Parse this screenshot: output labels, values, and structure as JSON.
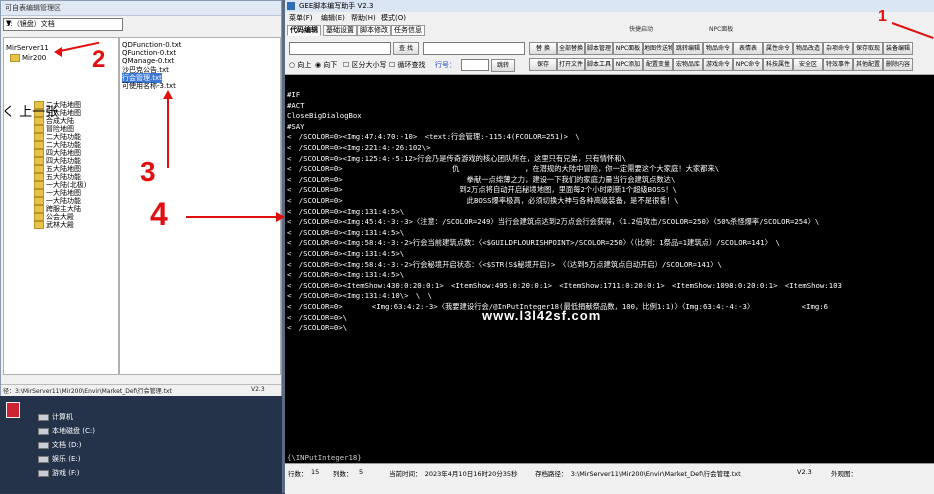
{
  "left_window": {
    "title": "可自表编辑管理区",
    "path_combo": "3:（镜盘）文档",
    "tree_root": "MirServer11",
    "tree_sub": "Mir200",
    "tree_items": [
      "二大陆地图",
      "三大陆地图",
      "合成大陆",
      "冒险地图",
      "二大陆功能",
      "二大陆功能",
      "四大陆地图",
      "四大陆功能",
      "五大陆地图",
      "五大陆功能",
      "一大陆(北极)",
      "一大陆地图",
      "一大陆功能",
      "跨服主大陆",
      "公会大殿",
      "武林大殿"
    ],
    "files": [
      "QDFunction-0.txt",
      "QFunction-0.txt",
      "QManage-0.txt",
      "沙巴克公告.txt",
      "行会管理.txt",
      "可使用名称-3.txt"
    ],
    "selected_file": "行会管理.txt",
    "status_path": "径：3:\\MirServer11\\Mir200\\Envir\\Market_Def\\行会管理.txt",
    "status_version": "V2.3"
  },
  "desktop": {
    "items": [
      "计算机",
      "本地磁盘 (C:)",
      "文档 (D:)",
      "娱乐 (E:)",
      "游戏 (F:)"
    ]
  },
  "right_window": {
    "title": "GEE脚本编写助手 V2.3",
    "menu": [
      "菜单(F)",
      "编辑(E)",
      "帮助(H)",
      "模式(O)"
    ],
    "tabs": [
      "代码编辑",
      "基础设置",
      "脚本修改",
      "任务信息"
    ],
    "group_labels": {
      "quick": "快捷启动",
      "npc": "NPC面板"
    },
    "search_btn": "查 找",
    "toolbar_row1": [
      "替 换",
      "全部替换",
      "脚本管理",
      "NPC面板",
      "地图传送物品",
      "跳转编辑",
      "物品命令",
      "表情表",
      "属性命令",
      "物品改造",
      "杂项命令",
      "保存取现",
      "装备编辑"
    ],
    "radio_up": "向上",
    "radio_down": "向下",
    "check_case": "区分大小写",
    "check_loop": "循环查找",
    "line_label": "行号：",
    "goto_btn": "跳转",
    "toolbar_row2": [
      "保存",
      "打开文件",
      "脚本工具",
      "NPC添加",
      "配置变量",
      "宏物品库",
      "游戏命令",
      "NPC命令",
      "科技属性",
      "安全区",
      "特效事件",
      "其他配置",
      "删除内容"
    ]
  },
  "editor_lines": [
    "#IF",
    "#ACT",
    "CloseBigDialogBox",
    "#SAY",
    "<　/SCOLOR=0><Img:47:4:70:-10>　<text:行会管理:-115:4(FCOLOR=251)>　\\",
    "<　/SCOLOR=0><Img:221:4:-26:102\\>",
    "<　/SCOLOR=0><Img:125:4:-5:12>行会乃是传奇游戏的核心团队所在，这里只有兄弟，只有情怀和\\",
    "<　/SCOLOR=0>　　　　　　　　　　　　　　　仇　　　　　　　　　，在潜规的大陆中冒险，你一定需要这个大家庭！大家都来\\",
    "<　/SCOLOR=0>　　　　　　　　　　　　　　　　　拳献一点绵薄之力，建设一下我们的家庭力量当行会建筑点数达\\",
    "<　/SCOLOR=0>　　　　　　　　　　　　　　　　到2万点将自动开启秘境地图，里面每2个小时刷新1个超级BOSS！\\",
    "<　/SCOLOR=0>　　　　　　　　　　　　　　　　　此BOSS爆率极高，必须切换大神与各种高级装备，是不是很香！\\",
    "<　/SCOLOR=0><Img:131:4:5>\\",
    "<　/SCOLOR=0><Img:45:4:-3:-3>〈注意：/SCOLOR=249〉当行会建筑点达到2万点会行会获得，〈1.2倍攻击/SCOLOR=250〉〈50%杀怪爆率/SCOLOR=254〉\\",
    "<　/SCOLOR=0><Img:131:4:5>\\",
    "<　/SCOLOR=0><Img:58:4:-3:-2>行会当前建筑点数：〈<$GUILDFLOURISHPOINT>/SCOLOR=250〉〈（比例：1祭品=1建筑点）/SCOLOR=141〉　\\",
    "<　/SCOLOR=0><Img:131:4:5>\\",
    "<　/SCOLOR=0><Img:58:4:-3:-2>行会秘境开启状态：〈<$STR(S$秘境开启)>　〈（达到5万点建筑点自动开启）/SCOLOR=141〉\\",
    "<　/SCOLOR=0><Img:131:4:5>\\",
    "<　/SCOLOR=0><ItemShow:430:0:20:0:1>　<ItemShow:495:0:20:0:1>　<ItemShow:1711:0:20:0:1>　<ItemShow:1098:0:20:0:1>　<ItemShow:103",
    "<　/SCOLOR=0><Img:131:4:10\\>　\\　\\",
    "<　/SCOLOR=0>　　　　<Img:63:4:2:-3>〈我要建设行会/@InPutInteger18(最低捐献祭品数，100，比例1:1)〉〈Img:63:4:-4:-3〉　　　　　　　<Img:6",
    "<　/SCOLOR=0>\\",
    "<　/SCOLOR=0>\\"
  ],
  "editor_footer": "{\\INPutInteger18}",
  "watermark": "www.l3l42sf.com",
  "status_bar": {
    "row_label": "行数：",
    "row_value": "15",
    "col_label": "列数：",
    "col_value": "5",
    "time": "当前时间：　2023年4月10日16时20分35秒",
    "path": "存档路径：　3:\\MirServer11\\Mir200\\Envir\\Market_Def\\行会管理.txt",
    "version": "V2.3",
    "stored_label": "外观图："
  },
  "annotations": {
    "num1": "1",
    "num2": "2",
    "num3": "3",
    "num4": "4",
    "prev_label": "く 上一张",
    "color": "#e01010"
  }
}
